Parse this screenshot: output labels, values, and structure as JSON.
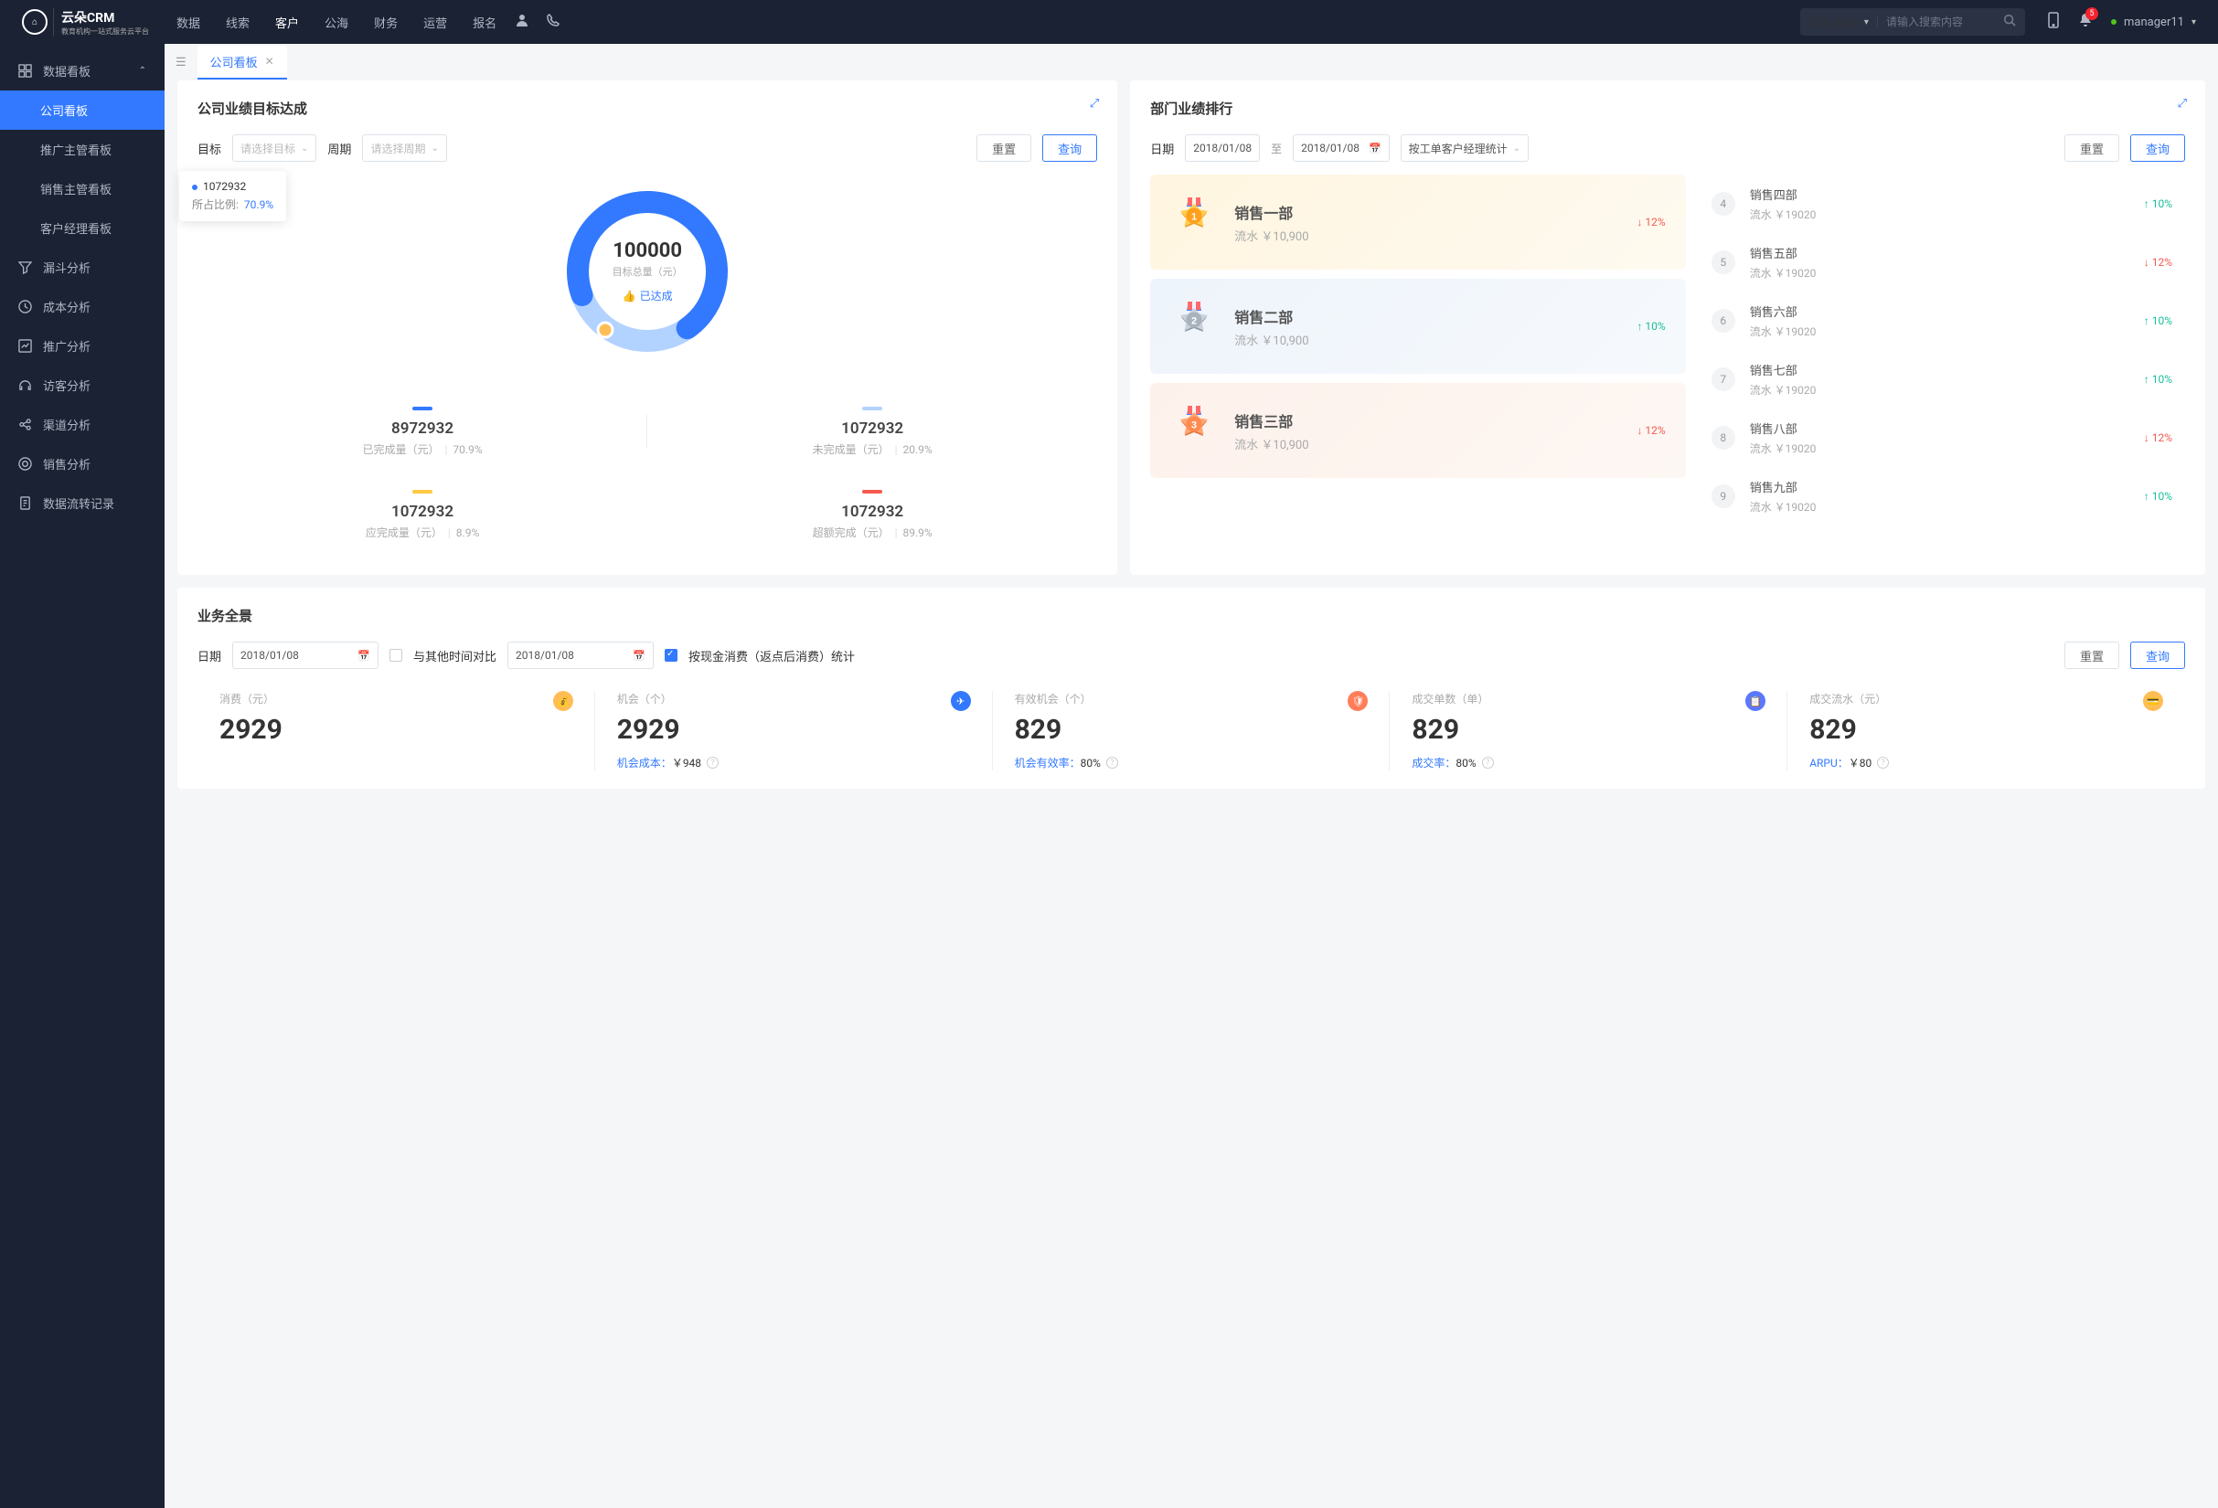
{
  "topnav": {
    "logo_main": "云朵CRM",
    "logo_sub": "教育机构一站式服务云平台",
    "items": [
      "数据",
      "线索",
      "客户",
      "公海",
      "财务",
      "运营",
      "报名"
    ],
    "search_type": "手机号码",
    "search_placeholder": "请输入搜索内容",
    "notif_count": "5",
    "username": "manager11"
  },
  "sidebar": {
    "group_label": "数据看板",
    "items": [
      "公司看板",
      "推广主管看板",
      "销售主管看板",
      "客户经理看板"
    ],
    "rest": [
      "漏斗分析",
      "成本分析",
      "推广分析",
      "访客分析",
      "渠道分析",
      "销售分析",
      "数据流转记录"
    ]
  },
  "tab": {
    "label": "公司看板"
  },
  "target_panel": {
    "title": "公司业绩目标达成",
    "target_label": "目标",
    "target_placeholder": "请选择目标",
    "period_label": "周期",
    "period_placeholder": "请选择周期",
    "reset": "重置",
    "query": "查询",
    "tooltip_value": "1072932",
    "tooltip_ratio_label": "所占比例:",
    "tooltip_ratio": "70.9%",
    "donut_value": "100000",
    "donut_label": "目标总量（元）",
    "donut_badge": "已达成",
    "stats": [
      {
        "bar": "#3279ff",
        "value": "8972932",
        "label": "已完成量（元）",
        "pct": "70.9%"
      },
      {
        "bar": "#b2d2ff",
        "value": "1072932",
        "label": "未完成量（元）",
        "pct": "20.9%"
      },
      {
        "bar": "#ffc940",
        "value": "1072932",
        "label": "应完成量（元）",
        "pct": "8.9%"
      },
      {
        "bar": "#f5594e",
        "value": "1072932",
        "label": "超额完成（元）",
        "pct": "89.9%"
      }
    ]
  },
  "ranking_panel": {
    "title": "部门业绩排行",
    "date_label": "日期",
    "date_from": "2018/01/08",
    "date_to": "2018/01/08",
    "date_sep": "至",
    "mode": "按工单客户经理统计",
    "reset": "重置",
    "query": "查询",
    "top3": [
      {
        "name": "销售一部",
        "sub": "流水 ￥10,900",
        "trend": "12%",
        "dir": "down"
      },
      {
        "name": "销售二部",
        "sub": "流水 ￥10,900",
        "trend": "10%",
        "dir": "up"
      },
      {
        "name": "销售三部",
        "sub": "流水 ￥10,900",
        "trend": "12%",
        "dir": "down"
      }
    ],
    "list": [
      {
        "num": "4",
        "name": "销售四部",
        "sub": "流水 ￥19020",
        "trend": "10%",
        "dir": "up"
      },
      {
        "num": "5",
        "name": "销售五部",
        "sub": "流水 ￥19020",
        "trend": "12%",
        "dir": "down"
      },
      {
        "num": "6",
        "name": "销售六部",
        "sub": "流水 ￥19020",
        "trend": "10%",
        "dir": "up"
      },
      {
        "num": "7",
        "name": "销售七部",
        "sub": "流水 ￥19020",
        "trend": "10%",
        "dir": "up"
      },
      {
        "num": "8",
        "name": "销售八部",
        "sub": "流水 ￥19020",
        "trend": "12%",
        "dir": "down"
      },
      {
        "num": "9",
        "name": "销售九部",
        "sub": "流水 ￥19020",
        "trend": "10%",
        "dir": "up"
      }
    ]
  },
  "panorama": {
    "title": "业务全景",
    "date_label": "日期",
    "date": "2018/01/08",
    "compare_label": "与其他时间对比",
    "compare_date": "2018/01/08",
    "checkbox_label": "按现金消费（返点后消费）统计",
    "reset": "重置",
    "query": "查询",
    "kpis": [
      {
        "label": "消费（元）",
        "value": "2929",
        "sub": "",
        "pct": "",
        "icon_bg": "#ffbe55"
      },
      {
        "label": "机会（个）",
        "value": "2929",
        "sub": "机会成本：",
        "pct": "￥948",
        "icon_bg": "#3279ff"
      },
      {
        "label": "有效机会（个）",
        "value": "829",
        "sub": "机会有效率：",
        "pct": "80%",
        "icon_bg": "#ff7d59"
      },
      {
        "label": "成交单数（单）",
        "value": "829",
        "sub": "成交率：",
        "pct": "80%",
        "icon_bg": "#5a78ff"
      },
      {
        "label": "成交流水（元）",
        "value": "829",
        "sub": "ARPU：",
        "pct": "￥80",
        "icon_bg": "#ffbe55"
      }
    ]
  },
  "chart_data": {
    "type": "pie",
    "title": "目标总量（元）",
    "total": 100000,
    "series": [
      {
        "name": "已完成量（元）",
        "value": 8972932,
        "pct": 70.9,
        "color": "#3279ff"
      },
      {
        "name": "未完成量（元）",
        "value": 1072932,
        "pct": 20.9,
        "color": "#b2d2ff"
      },
      {
        "name": "应完成量（元）",
        "value": 1072932,
        "pct": 8.9,
        "color": "#ffc940"
      },
      {
        "name": "超额完成（元）",
        "value": 1072932,
        "pct": 89.9,
        "color": "#f5594e"
      }
    ]
  }
}
